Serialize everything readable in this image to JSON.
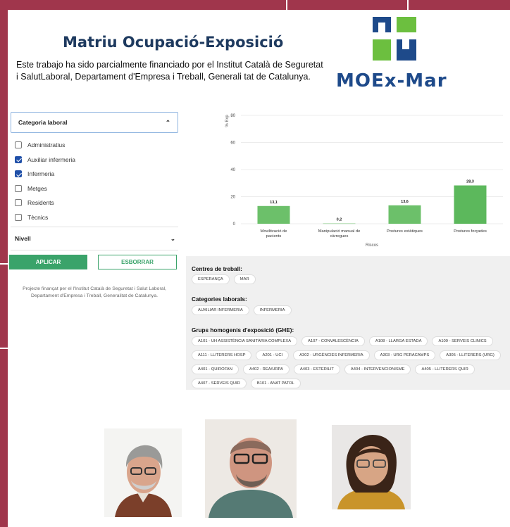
{
  "header": {
    "title": "Matriu Ocupació-Exposició",
    "funding": "Este trabajo ha sido parcialmente financiado por el Institut Català de Seguretat i SalutLaboral, Departament d'Empresa i Treball, Generali tat de Catalunya.",
    "brand": "MOEx-Mar"
  },
  "filters": {
    "category_title": "Categoria laboral",
    "items": [
      {
        "label": "Administratius",
        "checked": false
      },
      {
        "label": "Auxiliar infermeria",
        "checked": true
      },
      {
        "label": "Infermeria",
        "checked": true
      },
      {
        "label": "Metges",
        "checked": false
      },
      {
        "label": "Residents",
        "checked": false
      },
      {
        "label": "Tècnics",
        "checked": false
      }
    ],
    "level_title": "Nivell",
    "apply_label": "APLICAR",
    "clear_label": "ESBORRAR",
    "footnote": "Projecte finançat per el l'Institut Català de Seguretat i Salut Laboral, Departament d'Empresa i Treball, Generalitat de Catalunya."
  },
  "chart_data": {
    "type": "bar",
    "categories": [
      "Movilització de pacients",
      "Manipulació manual de càrregues",
      "Postures estàtiques",
      "Postures forçades"
    ],
    "values": [
      13.1,
      0.2,
      13.6,
      28.3
    ],
    "value_labels": [
      "13,1",
      "0,2",
      "13,6",
      "28,3"
    ],
    "ylabel": "% Exp",
    "xlabel": "Riscos",
    "ylim": [
      0,
      80
    ],
    "yticks": [
      "0",
      "20",
      "40",
      "60",
      "80"
    ],
    "colors": [
      "#6cc06a",
      "#6cc06a",
      "#6cc06a",
      "#5cb85c"
    ],
    "grid": true
  },
  "summary": {
    "centres_title": "Centres de treball:",
    "centres": [
      "ESPERANÇA",
      "MAR"
    ],
    "categories_title": "Categories laborals:",
    "categories": [
      "AUXILIAR INFERMERIA",
      "INFERMERIA"
    ],
    "groups_title": "Grups homogenis d'exposició (GHE):",
    "groups": [
      "A101 - UH ASSISTÈNCIA SANITÀRIA COMPLEXA",
      "A107 - CONVALESCÈNCIA",
      "A108 - LLARGA ESTADA",
      "A109 - SERVEIS CLINICS",
      "A111 - LLITERERS HOSP",
      "A201 - UCI",
      "A302 - URGÈNCIES INFERMERIA",
      "A303 - URG PERACAMPS",
      "A305 - LLITERERS (URG)",
      "A401 - QUIROFAN",
      "A402 - REA/URPA",
      "A403 - ESTERILIT",
      "A404 - INTERVENCIONISME",
      "A405 - LLITERERS QUIR",
      "A407 - SERVEIS QUIR",
      "B101 - ANAT PATOL"
    ]
  },
  "colors": {
    "background": "#a0364c",
    "accent_green": "#3aa36a",
    "brand_blue": "#1e4a8a",
    "title_navy": "#1e3a5f"
  }
}
